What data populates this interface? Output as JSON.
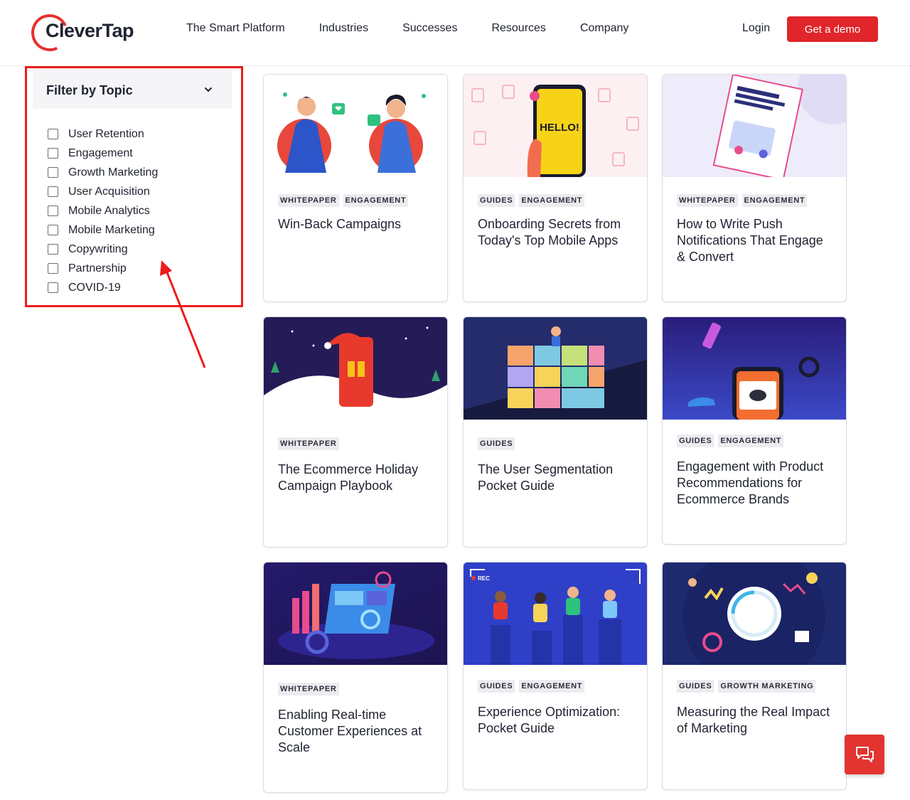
{
  "brand": {
    "name": "CleverTap",
    "accent": "#e0262b"
  },
  "nav": {
    "items": [
      "The Smart Platform",
      "Industries",
      "Successes",
      "Resources",
      "Company"
    ],
    "login": "Login",
    "demo": "Get a demo"
  },
  "filter": {
    "title": "Filter by Topic",
    "topics": [
      "User Retention",
      "Engagement",
      "Growth Marketing",
      "User Acquisition",
      "Mobile Analytics",
      "Mobile Marketing",
      "Copywriting",
      "Partnership",
      "COVID-19"
    ]
  },
  "cards": [
    {
      "tags": [
        "WHITEPAPER",
        "ENGAGEMENT"
      ],
      "title": "Win-Back Campaigns",
      "image": "chat-couple-illustration"
    },
    {
      "tags": [
        "GUIDES",
        "ENGAGEMENT"
      ],
      "title": "Onboarding Secrets from Today's Top Mobile Apps",
      "image": "hello-phone-illustration",
      "phone_text": "HELLO!"
    },
    {
      "tags": [
        "WHITEPAPER",
        "ENGAGEMENT"
      ],
      "title": "How to Write Push Notifications That Engage & Convert",
      "image": "ebook-cover-illustration"
    },
    {
      "tags": [
        "WHITEPAPER"
      ],
      "title": "The Ecommerce Holiday Campaign Playbook",
      "image": "holiday-phone-illustration"
    },
    {
      "tags": [
        "GUIDES"
      ],
      "title": "The User Segmentation Pocket Guide",
      "image": "segmentation-grid-illustration"
    },
    {
      "tags": [
        "GUIDES",
        "ENGAGEMENT"
      ],
      "title": "Engagement with Product Recommendations for Ecommerce Brands",
      "image": "product-recommendation-illustration"
    },
    {
      "tags": [
        "WHITEPAPER"
      ],
      "title": "Enabling Real-time Customer Experiences at Scale",
      "image": "realtime-dashboard-illustration"
    },
    {
      "tags": [
        "GUIDES",
        "ENGAGEMENT"
      ],
      "title": "Experience Optimization: Pocket Guide",
      "image": "rec-screen-illustration",
      "rec_text": "REC"
    },
    {
      "tags": [
        "GUIDES",
        "GROWTH MARKETING"
      ],
      "title": "Measuring the Real Impact of Marketing",
      "image": "impact-gauge-illustration"
    }
  ]
}
